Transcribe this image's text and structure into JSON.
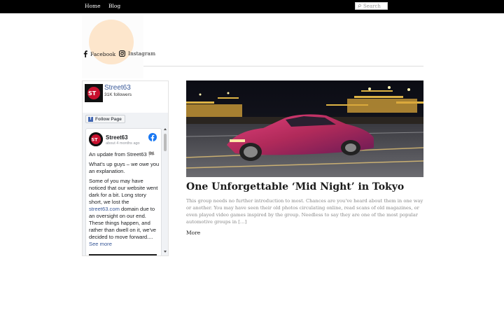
{
  "nav": {
    "home": "Home",
    "blog": "Blog"
  },
  "search": {
    "placeholder": "Search"
  },
  "social": {
    "facebook": "Facebook",
    "instagram": "Instagram"
  },
  "fb_widget": {
    "page_name": "Street63",
    "followers": "31K followers",
    "follow_label": "Follow Page",
    "post": {
      "author": "Street63",
      "time": "about 4 months ago",
      "p1": "An update from Street63 🏁",
      "p2": "What's up guys – we owe you an explanation.",
      "p3_a": "Some of you may have noticed that our website went dark for a bit. Long story short, we lost the ",
      "p3_link": "street63.com",
      "p3_b": " domain due to an oversight on our end. These things happen, and rather than dwell on it, we've decided to move forward.... ",
      "see_more": "See more"
    }
  },
  "article": {
    "title": "One Unforgettable ‘Mid Night’ in Tokyo",
    "excerpt": "This group needs no further introduction to most. Chances are you've heard about them in one way or another. You may have seen their old photos circulating online, read scans of old magazines, or even played video games inspired by the group. Needless to say they are one of the most popular automotive groups in […]",
    "more": "More"
  },
  "colors": {
    "topbar": "#000000",
    "link_blue": "#385898",
    "fb_blue": "#1877f2",
    "car": "#b02a5a"
  },
  "icons": [
    "search-icon",
    "facebook-icon",
    "instagram-icon",
    "facebook-logo-icon"
  ]
}
